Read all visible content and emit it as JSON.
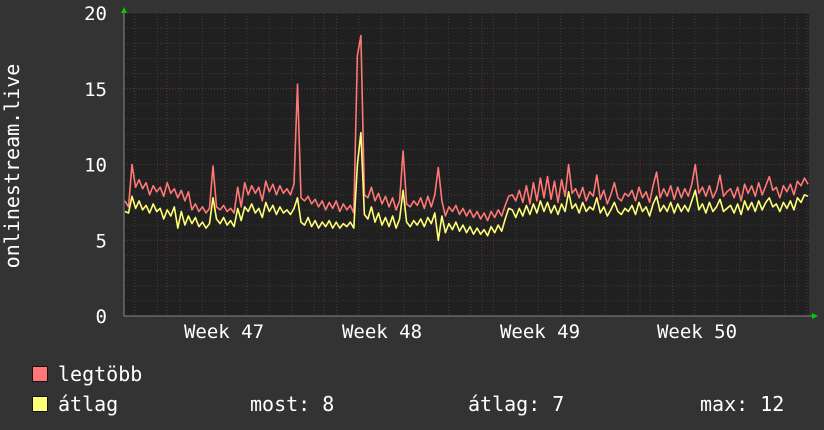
{
  "chart_data": {
    "type": "line",
    "ylabel": "onlinestream.live",
    "ylim": [
      0,
      20
    ],
    "yticks": [
      0,
      5,
      10,
      15,
      20
    ],
    "xticks": [
      "Week 47",
      "Week 48",
      "Week 49",
      "Week 50"
    ],
    "grid": true,
    "series": [
      {
        "name": "legtöbb",
        "color": "#ff7777",
        "values": [
          7.6,
          7.2,
          10.0,
          8.5,
          9.0,
          8.4,
          8.8,
          8.0,
          8.6,
          8.2,
          8.5,
          7.9,
          8.8,
          8.1,
          8.4,
          7.8,
          8.3,
          7.6,
          8.2,
          7.0,
          7.4,
          6.9,
          7.2,
          6.8,
          7.1,
          9.9,
          7.2,
          7.0,
          7.3,
          6.9,
          7.1,
          6.8,
          8.5,
          7.2,
          8.8,
          8.0,
          8.6,
          8.1,
          8.5,
          7.6,
          8.9,
          8.2,
          8.7,
          8.0,
          8.6,
          8.1,
          8.4,
          8.0,
          8.7,
          15.3,
          7.8,
          7.6,
          7.9,
          7.4,
          7.7,
          7.2,
          7.6,
          7.0,
          7.5,
          7.1,
          7.6,
          6.9,
          7.4,
          7.0,
          7.3,
          6.8,
          17.2,
          18.5,
          8.0,
          7.8,
          8.5,
          7.6,
          8.1,
          7.4,
          7.9,
          7.2,
          7.8,
          7.0,
          7.6,
          10.9,
          7.4,
          7.2,
          7.6,
          7.3,
          7.8,
          7.1,
          7.9,
          7.2,
          8.0,
          9.8,
          7.6,
          6.6,
          7.2,
          6.9,
          7.3,
          6.7,
          7.1,
          6.6,
          7.0,
          6.5,
          6.9,
          6.4,
          6.8,
          6.3,
          6.9,
          6.5,
          7.0,
          6.6,
          7.3,
          7.9,
          8.0,
          7.6,
          8.3,
          7.5,
          8.6,
          7.4,
          8.8,
          7.6,
          9.1,
          7.8,
          9.2,
          7.7,
          8.9,
          7.5,
          9.0,
          7.9,
          10.0,
          8.1,
          8.4,
          7.8,
          8.5,
          7.6,
          8.2,
          7.9,
          9.3,
          7.7,
          8.3,
          7.4,
          8.0,
          8.8,
          7.8,
          7.6,
          8.1,
          7.9,
          8.3,
          7.6,
          8.5,
          7.8,
          8.2,
          7.5,
          8.6,
          9.5,
          7.8,
          8.4,
          7.9,
          8.6,
          7.7,
          8.5,
          7.8,
          8.4,
          7.9,
          8.7,
          10.0,
          8.1,
          8.5,
          7.9,
          8.6,
          7.8,
          8.3,
          9.3,
          7.9,
          8.2,
          8.4,
          7.8,
          8.5,
          7.6,
          8.7,
          8.1,
          8.6,
          7.9,
          8.8,
          8.0,
          8.6,
          9.2,
          8.3,
          8.5,
          7.8,
          8.6,
          8.2,
          8.7,
          8.0,
          8.9,
          8.6,
          9.1,
          8.7
        ]
      },
      {
        "name": "átlag",
        "color": "#ffff77",
        "values": [
          6.9,
          6.8,
          7.9,
          7.1,
          7.6,
          7.0,
          7.3,
          6.8,
          7.4,
          6.9,
          7.1,
          6.4,
          7.0,
          6.6,
          7.2,
          5.8,
          6.9,
          6.0,
          6.6,
          6.1,
          6.5,
          5.9,
          6.2,
          5.8,
          6.1,
          7.8,
          6.4,
          6.1,
          6.5,
          6.0,
          6.3,
          5.9,
          7.1,
          6.3,
          7.2,
          6.9,
          7.4,
          6.8,
          7.1,
          6.5,
          7.5,
          6.9,
          7.3,
          6.7,
          7.2,
          6.8,
          7.0,
          6.7,
          7.1,
          7.8,
          6.2,
          6.0,
          6.5,
          5.9,
          6.3,
          5.8,
          6.2,
          5.9,
          6.3,
          5.8,
          6.2,
          5.8,
          6.1,
          5.9,
          6.2,
          5.8,
          10.0,
          12.1,
          6.7,
          6.4,
          7.2,
          6.2,
          6.8,
          6.0,
          6.5,
          5.9,
          6.6,
          5.8,
          6.4,
          8.3,
          6.2,
          5.9,
          6.3,
          6.0,
          6.4,
          5.9,
          6.5,
          6.1,
          6.8,
          5.0,
          6.6,
          5.5,
          6.1,
          5.7,
          6.2,
          5.6,
          6.0,
          5.5,
          5.9,
          5.4,
          5.8,
          5.4,
          5.7,
          5.3,
          5.9,
          5.5,
          6.0,
          5.6,
          6.4,
          7.1,
          7.0,
          6.5,
          7.1,
          6.6,
          7.3,
          6.7,
          7.4,
          6.8,
          7.6,
          6.9,
          7.5,
          6.8,
          7.3,
          6.7,
          7.4,
          6.9,
          8.2,
          7.1,
          7.4,
          6.8,
          7.5,
          6.9,
          7.2,
          7.0,
          7.8,
          6.8,
          7.2,
          6.6,
          7.0,
          7.5,
          6.9,
          6.7,
          7.1,
          6.9,
          7.3,
          6.7,
          7.5,
          6.9,
          7.2,
          6.6,
          7.4,
          7.9,
          6.9,
          7.3,
          6.9,
          7.5,
          6.8,
          7.4,
          6.9,
          7.3,
          6.9,
          7.6,
          8.3,
          7.0,
          7.4,
          6.8,
          7.5,
          6.9,
          7.2,
          7.7,
          6.9,
          7.1,
          7.3,
          6.8,
          7.4,
          6.7,
          7.6,
          7.0,
          7.5,
          6.9,
          7.6,
          7.0,
          7.5,
          7.8,
          7.2,
          7.4,
          6.9,
          7.5,
          7.1,
          7.6,
          7.0,
          7.8,
          7.5,
          8.0,
          7.9
        ]
      }
    ]
  },
  "legend": {
    "items": [
      {
        "label": "legtöbb",
        "color": "#ff7777"
      },
      {
        "label": "átlag",
        "color": "#ffff77"
      }
    ],
    "stats": {
      "most": "most: 8",
      "atlag": "átlag: 7",
      "max": "max: 12"
    }
  }
}
